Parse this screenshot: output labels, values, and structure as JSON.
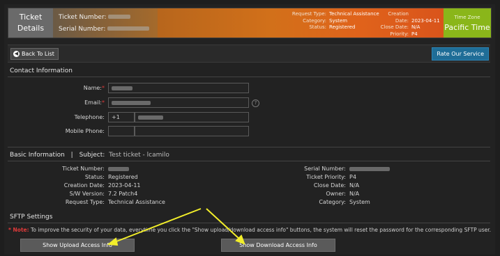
{
  "header": {
    "title_line1": "Ticket",
    "title_line2": "Details",
    "ticket_number_label": "Ticket Number:",
    "serial_number_label": "Serial Number:",
    "request_type_label": "Request Type:",
    "request_type": "Technical Assistance",
    "category_label": "Category:",
    "category": "System",
    "status_label": "Status:",
    "status": "Registered",
    "creation_date_label": "Creation Date:",
    "creation_date": "2023-04-11",
    "close_date_label": "Close Date:",
    "close_date": "N/A",
    "priority_label": "Priority:",
    "priority": "P4",
    "timezone_label": "Time Zone",
    "timezone": "Pacific Time"
  },
  "toolbar": {
    "back_label": "Back To List",
    "rate_label": "Rate Our Service"
  },
  "contact": {
    "heading": "Contact Information",
    "name_label": "Name:",
    "email_label": "Email:",
    "telephone_label": "Telephone:",
    "telephone_code": "+1",
    "mobile_label": "Mobile Phone:",
    "required_mark": "*",
    "help_glyph": "?"
  },
  "basic": {
    "heading": "Basic Information",
    "separator": "|",
    "subject_label": "Subject:",
    "subject": "Test ticket - lcamilo",
    "left": [
      {
        "label": "Ticket Number:",
        "value": ""
      },
      {
        "label": "Status:",
        "value": "Registered"
      },
      {
        "label": "Creation Date:",
        "value": "2023-04-11"
      },
      {
        "label": "S/W Version:",
        "value": "7.2 Patch4"
      },
      {
        "label": "Request Type:",
        "value": "Technical Assistance"
      }
    ],
    "right": [
      {
        "label": "Serial Number:",
        "value": ""
      },
      {
        "label": "Ticket Priority:",
        "value": "P4"
      },
      {
        "label": "Close Date:",
        "value": "N/A"
      },
      {
        "label": "Owner:",
        "value": "N/A"
      },
      {
        "label": "Category:",
        "value": "System"
      }
    ]
  },
  "sftp": {
    "heading": "SFTP Settings",
    "note_label": "* Note:",
    "note_text": " To improve the security of your data, everytime you click the \"Show upload/download access info\" buttons, the system will reset the password for the corresponding SFTP user.",
    "upload_button": "Show Upload Access Info",
    "download_button": "Show Download Access Info"
  },
  "colors": {
    "header_orange": "#d2701a",
    "timezone_green": "#8ab61a",
    "rate_button_blue": "#1f6d97",
    "arrow_yellow": "#f2ee2a"
  },
  "icons": [
    "back-arrow-icon",
    "help-icon",
    "annotation-arrow-icon"
  ]
}
